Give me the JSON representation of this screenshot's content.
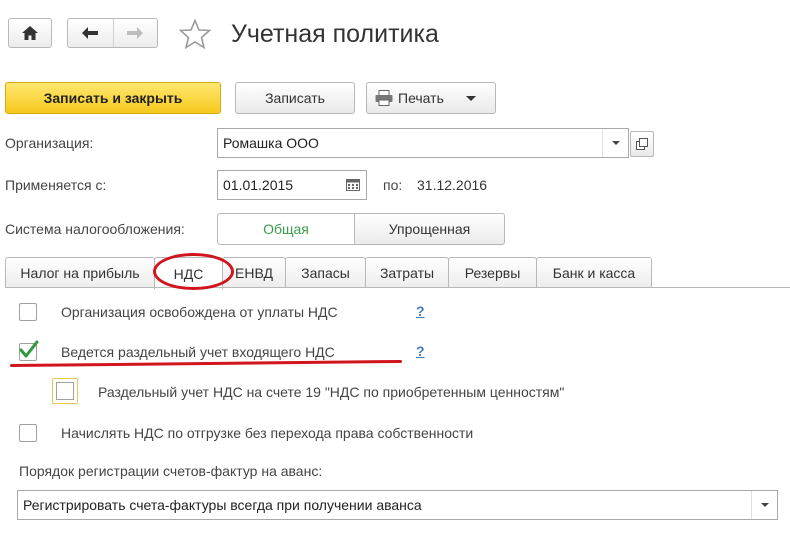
{
  "header": {
    "title": "Учетная политика"
  },
  "toolbar": {
    "save_close_label": "Записать и закрыть",
    "save_label": "Записать",
    "print_label": "Печать"
  },
  "form": {
    "org_label": "Организация:",
    "org_value": "Ромашка ООО",
    "applies_label": "Применяется с:",
    "date_from": "01.01.2015",
    "to_label": "по:",
    "date_to": "31.12.2016",
    "tax_label": "Система налогообложения:",
    "tax_options": [
      "Общая",
      "Упрощенная"
    ],
    "tax_selected": "Общая"
  },
  "tabs": [
    {
      "label": "Налог на прибыль"
    },
    {
      "label": "НДС",
      "active": true
    },
    {
      "label": "ЕНВД"
    },
    {
      "label": "Запасы"
    },
    {
      "label": "Затраты"
    },
    {
      "label": "Резервы"
    },
    {
      "label": "Банк и касса"
    }
  ],
  "vat": {
    "options": [
      {
        "label": "Организация освобождена от уплаты НДС",
        "checked": false,
        "help": "?"
      },
      {
        "label": "Ведется раздельный учет входящего НДС",
        "checked": true,
        "help": "?"
      },
      {
        "label": "Раздельный учет НДС на счете 19 \"НДС по приобретенным ценностям\"",
        "checked": false
      },
      {
        "label": "Начислять НДС по отгрузке без перехода права собственности",
        "checked": false
      }
    ],
    "invoice_label": "Порядок регистрации счетов-фактур на аванс:",
    "invoice_value": "Регистрировать счета-фактуры всегда при получении аванса"
  },
  "colors": {
    "accent_yellow": "#f6c91d",
    "tumbler_active": "#3a9d4e",
    "annotation_red": "#d2141e",
    "check_green": "#2f9a3c",
    "help_blue": "#3d7dbd"
  }
}
